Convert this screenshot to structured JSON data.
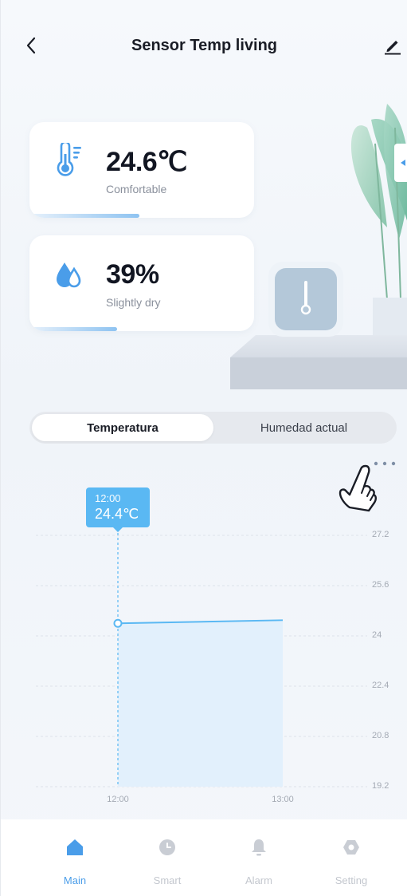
{
  "header": {
    "title": "Sensor Temp living",
    "back_icon": "chevron-left-icon",
    "edit_icon": "pencil-icon"
  },
  "temperature_card": {
    "value": "24.6℃",
    "status": "Comfortable",
    "icon": "thermometer-icon",
    "level": 0.49
  },
  "humidity_card": {
    "value": "39%",
    "status": "Slightly dry",
    "icon": "water-drop-icon",
    "level": 0.39
  },
  "tabs": {
    "active": "Temperatura",
    "inactive": "Humedad actual"
  },
  "chart": {
    "tooltip_time": "12:00",
    "tooltip_value": "24.4℃"
  },
  "chart_data": {
    "type": "area",
    "x": [
      "12:00",
      "13:00"
    ],
    "values": [
      24.4,
      24.5
    ],
    "yticks": [
      "27.2",
      "25.6",
      "24",
      "22.4",
      "20.8",
      "19.2"
    ],
    "ylim": [
      19.2,
      27.2
    ],
    "grid": true,
    "color": "#5ab8f3"
  },
  "bottom_nav": {
    "items": [
      {
        "label": "Main",
        "icon": "home-icon",
        "active": true
      },
      {
        "label": "Smart",
        "icon": "clock-icon",
        "active": false
      },
      {
        "label": "Alarm",
        "icon": "bell-icon",
        "active": false
      },
      {
        "label": "Setting",
        "icon": "settings-icon",
        "active": false
      }
    ]
  },
  "colors": {
    "accent": "#4a9de9",
    "chart_line": "#5ab8f3",
    "chart_fill": "#e2f0fc",
    "title": "#1a1d26",
    "muted": "#8a909c"
  }
}
